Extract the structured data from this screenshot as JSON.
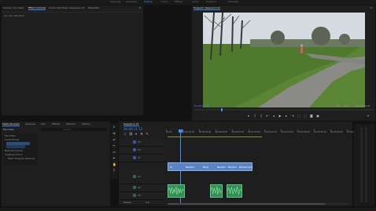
{
  "menu_tabs": [
    "Source: (no clips)",
    "Effect Controls",
    "Audio Clip Mixer: Sequence 01",
    "Metadata"
  ],
  "top_right_tabs": [
    "Learning",
    "Assembly",
    "Editing",
    "Color",
    "Effects",
    "Audio",
    "Graphics",
    "Libraries"
  ],
  "source_panel": {
    "empty_text": "(no clip selected)"
  },
  "program_monitor": {
    "title": "Program: Sequence 01",
    "timecode_current": "00:00:11:12",
    "fit_label": "Fit",
    "quality_label": "Full",
    "timecode_total": "00:00:13:04"
  },
  "project_panel": {
    "tabs": [
      "Media Browser",
      "Libraries",
      "Info",
      "Effects",
      "Markers",
      "History"
    ],
    "search_placeholder": "Search",
    "items": [
      {
        "label": "Favorites"
      },
      {
        "label": "Local Drives"
      },
      {
        "label": "Network Drives"
      },
      {
        "label": "Creative Cloud"
      },
      {
        "label": "Team Projects Versions"
      }
    ],
    "header_label": "Favorites"
  },
  "timeline": {
    "tab": "Sequence 01",
    "timecode": "00:00:11:12",
    "ruler_labels": [
      "00:00",
      "00:00:02:00",
      "00:00:04:00",
      "00:00:06:00",
      "00:00:08:00",
      "00:00:10:00",
      "00:00:12:00",
      "00:00:14:00",
      "00:00:16:00",
      "00:00:18:00",
      "00:00:20:00",
      "00:00:22:00"
    ],
    "tracks": [
      {
        "name": "V3",
        "type": "video"
      },
      {
        "name": "V2",
        "type": "video"
      },
      {
        "name": "V1",
        "type": "video"
      },
      {
        "name": "A1",
        "type": "audio"
      },
      {
        "name": "A2",
        "type": "audio"
      },
      {
        "name": "A3",
        "type": "audio"
      },
      {
        "name": "Master",
        "type": "master"
      }
    ],
    "video_clips": [
      "fx",
      "Nested",
      "Nest",
      "Nested",
      "Nested",
      "Nested Seq"
    ],
    "master_value": "0.0"
  },
  "colors": {
    "accent": "#3d8ef8",
    "video_clip": "#5b84c7",
    "audio_clip": "#2f8f52",
    "playhead": "#3d8ef8",
    "panel": "#1e1e1e",
    "background": "#121212"
  }
}
